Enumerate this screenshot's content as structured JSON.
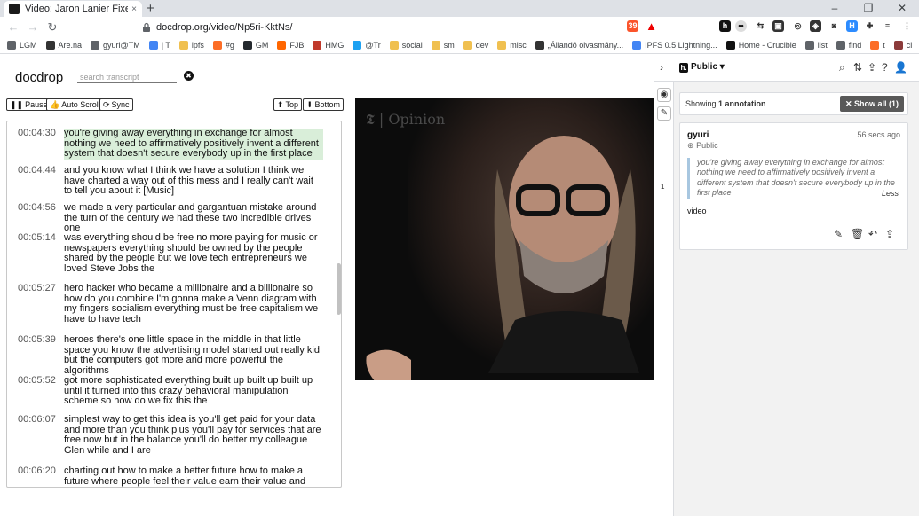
{
  "browser": {
    "tab_title": "Video: Jaron Lanier Fixes the In",
    "tab_close": "×",
    "new_tab": "+",
    "url_host": "docdrop.org",
    "url_path": "/video/Np5ri-KktNs/",
    "window_buttons": [
      "–",
      "❐",
      "✕"
    ],
    "nav": {
      "back": "←",
      "forward": "→",
      "reload": "↻"
    },
    "extension_badge": "39"
  },
  "bookmarks": [
    {
      "label": "LGM",
      "icon": "globe-icon",
      "color": "#5f6368"
    },
    {
      "label": "Are.na",
      "icon": "arena-icon",
      "color": "#333333"
    },
    {
      "label": "gyuri@TM",
      "icon": "person-icon",
      "color": "#5f6368"
    },
    {
      "label": "| T",
      "icon": "calendar-icon",
      "color": "#4285f4"
    },
    {
      "label": "ipfs",
      "icon": "folder-icon",
      "color": "#f0c050"
    },
    {
      "label": "#g",
      "icon": "gitlab-icon",
      "color": "#fc6d26"
    },
    {
      "label": "GM",
      "icon": "github-icon",
      "color": "#24292e"
    },
    {
      "label": "FJB",
      "icon": "refresh-icon",
      "color": "#ff6600"
    },
    {
      "label": "HMG",
      "icon": "bookmark-icon",
      "color": "#c0392b"
    },
    {
      "label": "@Tr",
      "icon": "twitter-icon",
      "color": "#1da1f2"
    },
    {
      "label": "social",
      "icon": "folder-icon",
      "color": "#f0c050"
    },
    {
      "label": "sm",
      "icon": "folder-icon",
      "color": "#f0c050"
    },
    {
      "label": "dev",
      "icon": "folder-icon",
      "color": "#f0c050"
    },
    {
      "label": "misc",
      "icon": "folder-icon",
      "color": "#f0c050"
    },
    {
      "label": "„Állandó olvasmány...",
      "icon": "s-icon",
      "color": "#333333"
    },
    {
      "label": "IPFS 0.5 Lightning...",
      "icon": "doc-icon",
      "color": "#4285f4"
    },
    {
      "label": "Home - Crucible",
      "icon": "c-icon",
      "color": "#111111"
    },
    {
      "label": "list",
      "icon": "puzzle-icon",
      "color": "#5f6368"
    },
    {
      "label": "find",
      "icon": "puzzle-icon",
      "color": "#5f6368"
    },
    {
      "label": "t",
      "icon": "gitlab-icon",
      "color": "#fc6d26"
    },
    {
      "label": "cl",
      "icon": "bug-icon",
      "color": "#8b3a3a"
    }
  ],
  "page": {
    "logo": "docdrop",
    "search_placeholder": "search transcript",
    "clear_icon": "✖",
    "controls": {
      "pause": "Pause",
      "autoscroll": "Auto Scroll",
      "sync": "Sync",
      "top": "Top",
      "bottom": "Bottom"
    },
    "video_brand": "Opinion",
    "video_logo": "𝕿"
  },
  "transcript": [
    {
      "time": "00:04:30",
      "text": "you're giving away everything in exchange for almost nothing we need to affirmatively positively invent a different system that doesn't secure everybody up in the first place",
      "highlighted": true
    },
    {
      "time": "00:04:44",
      "text": "and you know what I think we have a solution I think we have charted a way out of this mess and I really can't wait to tell you about it [Music]",
      "highlighted": false
    },
    {
      "time": "00:04:56",
      "text": "we made a very particular and gargantuan mistake around the turn of the century we had these two incredible drives one",
      "highlighted": false
    },
    {
      "time": "00:05:14",
      "text": "was everything should be free no more paying for music or newspapers everything should be owned by the people shared by the people but we love tech entrepreneurs we loved Steve Jobs the",
      "highlighted": false
    },
    {
      "time": "00:05:27",
      "text": "hero hacker who became a millionaire and a billionaire so how do you combine I'm gonna make a Venn diagram with my fingers socialism everything must be free capitalism we have to have tech",
      "highlighted": false
    },
    {
      "time": "00:05:39",
      "text": "heroes there's one little space in the middle in that little space you know the advertising model started out really kid but the computers got more and more powerful the algorithms",
      "highlighted": false
    },
    {
      "time": "00:05:52",
      "text": "got more sophisticated everything built up built up built up until it turned into this crazy behavioral manipulation scheme so how do we fix this the",
      "highlighted": false
    },
    {
      "time": "00:06:07",
      "text": "simplest way to get this idea is you'll get paid for your data and more than you think plus you'll pay for services that are free now but in the balance you'll do better my colleague Glen while and I are",
      "highlighted": false
    },
    {
      "time": "00:06:20",
      "text": "charting out how to make a better future how to make a future where people feel their value earn their value and have dignity",
      "highlighted": false
    }
  ],
  "hypothesis": {
    "group": "Public",
    "showing_prefix": "Showing",
    "showing_count": "1 annotation",
    "show_all": "Show all (1)",
    "rail_count": "1",
    "annotation": {
      "user": "gyuri",
      "visibility": "Public",
      "time": "56 secs ago",
      "quote": "you're giving away everything in exchange for almost nothing we need to affirmatively positively invent a different system that doesn't secure everybody up in the first place",
      "less": "Less",
      "body": "video"
    }
  }
}
